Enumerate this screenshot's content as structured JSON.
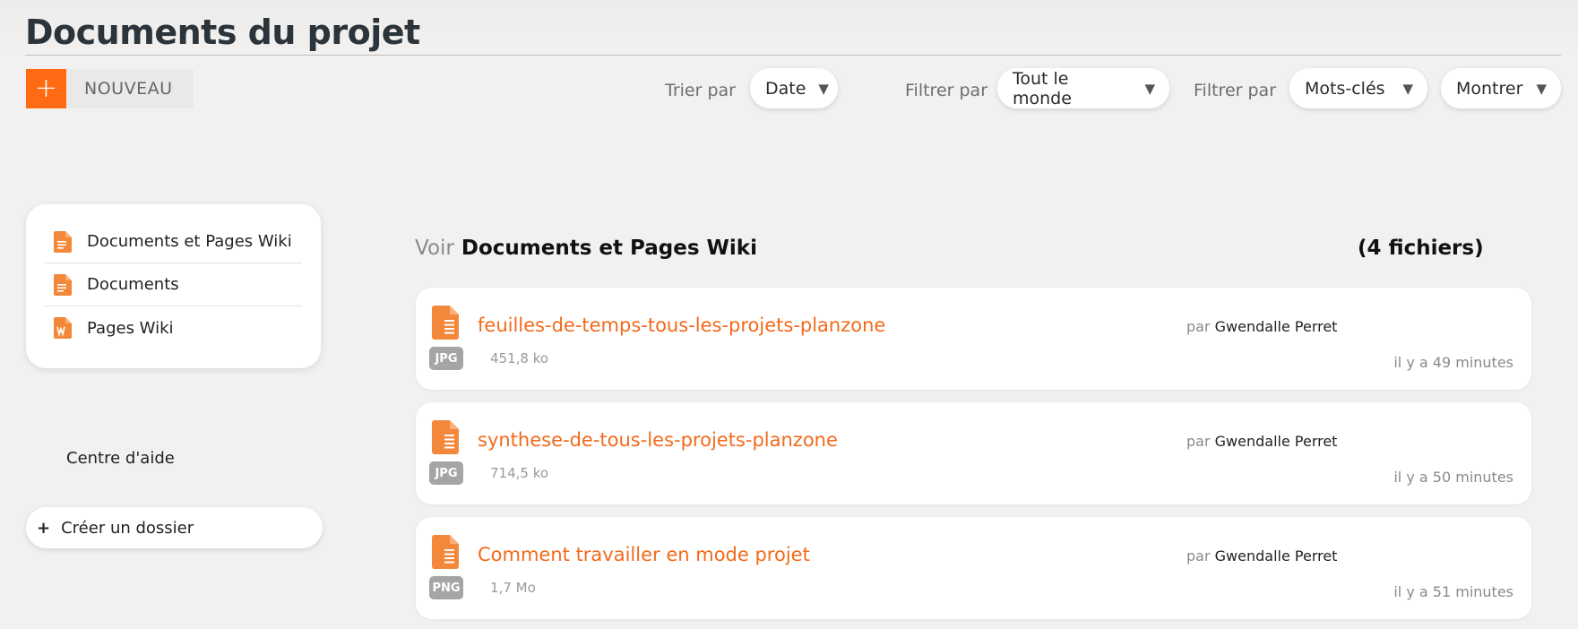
{
  "header": {
    "title": "Documents du projet",
    "new_plus": "+",
    "new_label": "NOUVEAU"
  },
  "toolbar": {
    "sort_label": "Trier par",
    "sort_value": "Date",
    "filter1_label": "Filtrer par",
    "filter1_value": "Tout le monde",
    "filter2_label": "Filtrer par",
    "filter2_value": "Mots-clés",
    "show_value": "Montrer",
    "caret": "▼"
  },
  "sidebar": {
    "items": [
      {
        "label": "Documents et Pages Wiki",
        "icon": "document-icon"
      },
      {
        "label": "Documents",
        "icon": "document-icon"
      },
      {
        "label": "Pages Wiki",
        "icon": "wiki-page-icon"
      }
    ],
    "help_label": "Centre d'aide",
    "create_plus": "+",
    "create_folder_label": "Créer un dossier"
  },
  "main": {
    "voir": "Voir",
    "section_title": "Documents et Pages Wiki",
    "count": "(4 fichiers)",
    "par": "par",
    "files": [
      {
        "name": "feuilles-de-temps-tous-les-projets-planzone",
        "type": "JPG",
        "size": "451,8 ko",
        "author": "Gwendalle Perret",
        "time": "il y a 49 minutes"
      },
      {
        "name": "synthese-de-tous-les-projets-planzone",
        "type": "JPG",
        "size": "714,5 ko",
        "author": "Gwendalle Perret",
        "time": "il y a 50 minutes"
      },
      {
        "name": "Comment travailler en mode projet",
        "type": "PNG",
        "size": "1,7 Mo",
        "author": "Gwendalle Perret",
        "time": "il y a 51 minutes"
      }
    ]
  },
  "colors": {
    "accent": "#ff6a13",
    "link": "#f26a1b",
    "badge": "#a5a5a5"
  }
}
